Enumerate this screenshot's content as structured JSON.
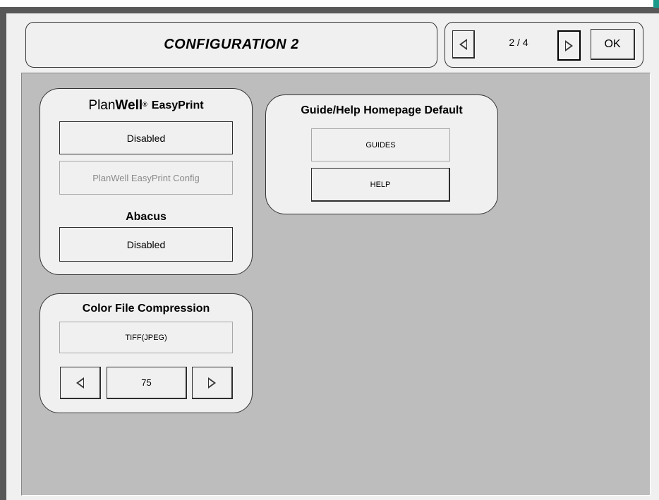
{
  "header": {
    "title": "CONFIGURATION 2",
    "page_indicator": "2 / 4",
    "prev_icon": "triangle-left-icon",
    "next_icon": "triangle-right-icon",
    "ok_label": "OK"
  },
  "planwell": {
    "logo_prefix": "Plan",
    "logo_bold": "Well",
    "logo_mark": "®",
    "product": "EasyPrint",
    "status_label": "Disabled",
    "config_label": "PlanWell EasyPrint Config"
  },
  "abacus": {
    "heading": "Abacus",
    "status_label": "Disabled"
  },
  "color_compression": {
    "heading": "Color File Compression",
    "format_value": "TIFF(JPEG)",
    "quality_value": "75",
    "decrease_icon": "triangle-left-icon",
    "increase_icon": "triangle-right-icon"
  },
  "guide_help": {
    "heading": "Guide/Help Homepage Default",
    "guides_label": "GUIDES",
    "help_label": "HELP"
  },
  "colors": {
    "frame": "#585858",
    "background": "#bdbdbd",
    "panel": "#f0f0f0",
    "accent": "#1a9a8a"
  }
}
